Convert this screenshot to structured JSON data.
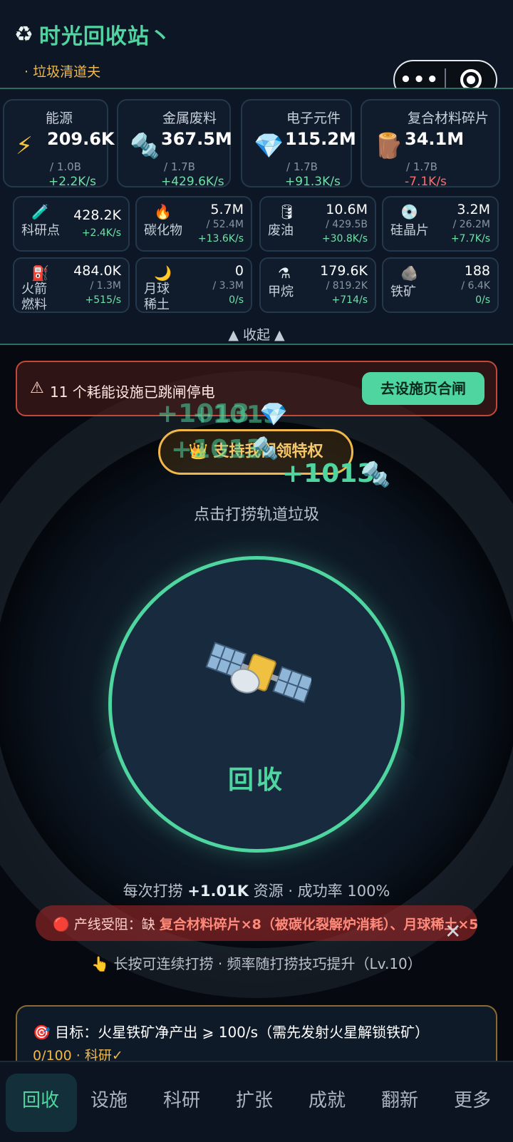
{
  "header": {
    "title": "时光回收站丶",
    "subtitle": "· 垃圾清道夫"
  },
  "resources_main": [
    {
      "name": "能源",
      "icon": "⚡",
      "value": "209.6K",
      "cap": "/ 1.0B",
      "rate": "+2.2K/s"
    },
    {
      "name": "金属废料",
      "icon": "🔩",
      "value": "367.5M",
      "cap": "/ 1.7B",
      "rate": "+429.6K/s"
    },
    {
      "name": "电子元件",
      "icon": "💎",
      "value": "115.2M",
      "cap": "/ 1.7B",
      "rate": "+91.3K/s"
    },
    {
      "name": "复合材料碎片",
      "icon": "🪵",
      "value": "34.1M",
      "cap": "/ 1.7B",
      "rate": "-7.1K/s"
    }
  ],
  "resources_row2": [
    {
      "name": "科研点",
      "icon": "🧪",
      "value": "428.2K",
      "cap": "",
      "rate": "+2.4K/s"
    },
    {
      "name": "碳化物",
      "icon": "🔥",
      "value": "5.7M",
      "cap": "/ 52.4M",
      "rate": "+13.6K/s"
    },
    {
      "name": "废油",
      "icon": "🛢",
      "value": "10.6M",
      "cap": "/ 429.5B",
      "rate": "+30.8K/s"
    },
    {
      "name": "硅晶片",
      "icon": "💿",
      "value": "3.2M",
      "cap": "/ 26.2M",
      "rate": "+7.7K/s"
    }
  ],
  "resources_row3": [
    {
      "name": "火箭 燃料",
      "icon": "⛽",
      "value": "484.0K",
      "cap": "/ 1.3M",
      "rate": "+515/s"
    },
    {
      "name": "月球 稀土",
      "icon": "🌙",
      "value": "0",
      "cap": "/ 3.3M",
      "rate": "0/s"
    },
    {
      "name": "甲烷",
      "icon": "⚗",
      "value": "179.6K",
      "cap": "/ 819.2K",
      "rate": "+714/s"
    },
    {
      "name": "铁矿",
      "icon": "🪨",
      "value": "188",
      "cap": "/ 6.4K",
      "rate": "0/s"
    }
  ],
  "collapse_label": "▲ 收起 ▲",
  "alert": {
    "icon": "⚠",
    "message": "11 个耗能设施已跳闸停电",
    "button": "去设施页合闸"
  },
  "floaters": [
    "+1013",
    "+1013",
    "+1013",
    "+1013"
  ],
  "vip_label": "👑 支持我们领特权",
  "hint": "点击打捞轨道垃圾",
  "recycle_label": "回收",
  "stats": {
    "prefix": "每次打捞 ",
    "amount": "+1.01K",
    "suffix": " 资源 · 成功率 100%"
  },
  "block": {
    "prefix": "🔴 产线受阻：缺 ",
    "highlight": "复合材料碎片×8（被碳化裂解炉消耗）、月球稀土×5",
    "close": "✕"
  },
  "longpress": "👆 长按可连续打捞 · 频率随打捞技巧提升（Lv.10）",
  "goal": {
    "line1": "🎯 目标：火星铁矿净产出 ⩾ 100/s（需先发射火星解锁铁矿）",
    "line2": "0/100 · 科研✓"
  },
  "nav": [
    "回收",
    "设施",
    "科研",
    "扩张",
    "成就",
    "翻新",
    "更多"
  ],
  "colors": {
    "accent": "#4fd6a0",
    "warning": "#f0b84a",
    "danger": "#ff6b6b"
  }
}
